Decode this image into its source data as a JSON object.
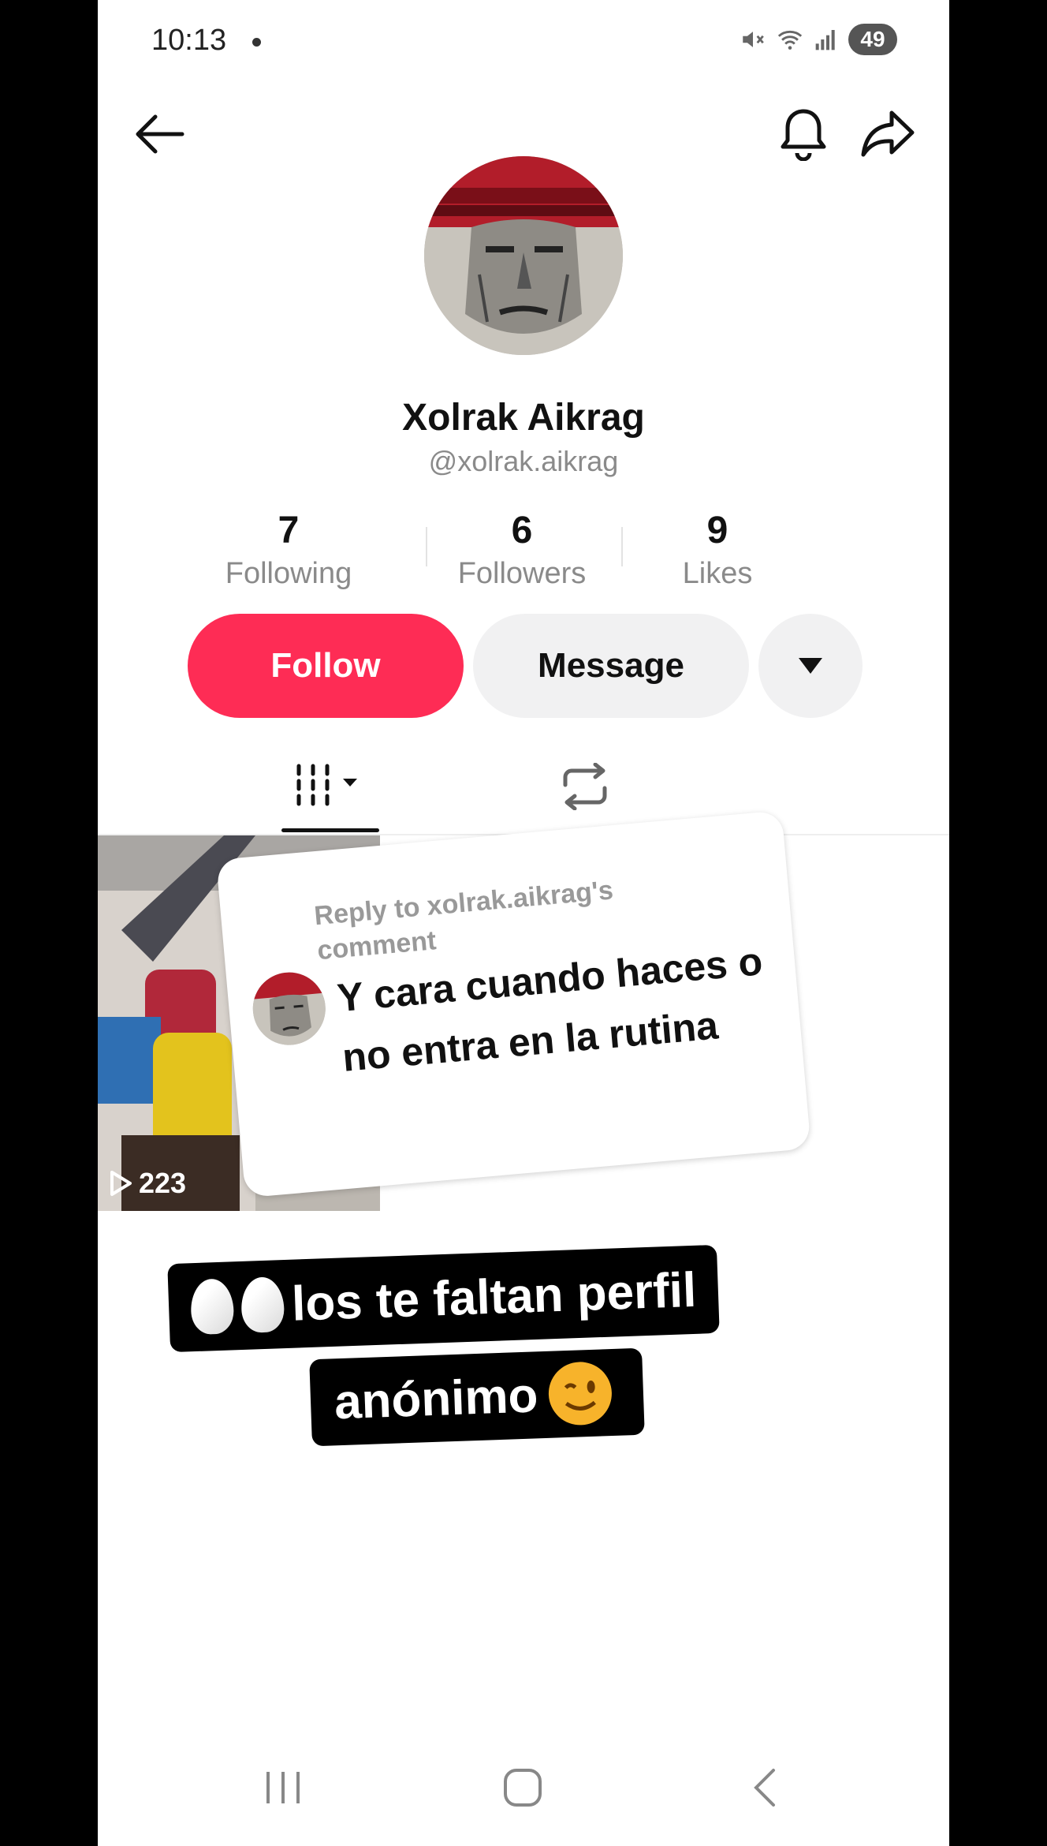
{
  "status_bar": {
    "time": "10:13",
    "battery": "49"
  },
  "profile": {
    "name": "Xolrak Aikrag",
    "handle": "@xolrak.aikrag"
  },
  "stats": [
    {
      "value": "7",
      "label": "Following"
    },
    {
      "value": "6",
      "label": "Followers"
    },
    {
      "value": "9",
      "label": "Likes"
    }
  ],
  "actions": {
    "follow": "Follow",
    "message": "Message"
  },
  "video": {
    "views": "223",
    "reply_header": "Reply to xolrak.aikrag's comment",
    "reply_text": "Y cara cuando haces o no entra en la rutina"
  },
  "caption": {
    "line1": "los te faltan perfil",
    "line2": "anónimo"
  },
  "colors": {
    "accent": "#FE2C55",
    "secondary_button": "#F1F1F2"
  }
}
